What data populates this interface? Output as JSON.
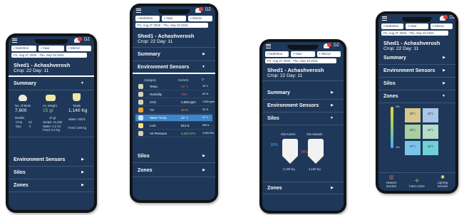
{
  "filters": {
    "chip1": "Nahshon",
    "chip2": "Yaar",
    "chip3": "She12"
  },
  "date_range": "Fri, Aug 27 2020 - Thu, Sep 23 2021",
  "user": "DZ",
  "shed": {
    "title": "Shed1 - Achashverosh",
    "crop_day": "Crop: 22  Day: 11"
  },
  "sections": {
    "summary": "Summary",
    "env": "Environment Sensors",
    "silos": "Silos",
    "zones": "Zones"
  },
  "summary": {
    "birds_label": "No. of Birds",
    "birds_value": "7,600",
    "avg_label": "Av. Weight",
    "avg_value": "15 gr",
    "totals_label": "Totals",
    "totals_value": "1,140 Kg",
    "deaths_label": "Deaths",
    "crop_label": "Crop",
    "crop_value": "24",
    "day_label": "Day",
    "day_value": "2",
    "w1": "10 gr",
    "jumps": "Jumps: 11,332",
    "water1": "Water: 0.2 ml",
    "feed1": "Feed: 0.2 Kg",
    "water2": "Water: 530 lt",
    "feed2": "Feed: 100 Kg"
  },
  "env": {
    "col_category": "Category",
    "col_current": "Current",
    "rows": [
      {
        "name": "Temp.",
        "value": "42 °c",
        "extra": "33 °c"
      },
      {
        "name": "Humidity",
        "value": "78%",
        "extra": "63 %"
      },
      {
        "name": "CO2",
        "value": "2,500 ppm",
        "extra": "1,500 ppm"
      },
      {
        "name": "TH",
        "value": "44 %",
        "extra": "33 %"
      },
      {
        "name": "Water Temp.",
        "value": "22 °c",
        "extra": "22 °c"
      },
      {
        "name": "LUX",
        "value": "812 lx",
        "extra": "600 lx"
      },
      {
        "name": "Air Pressure",
        "value": "3,454 KPA",
        "extra": "3,000 kPa"
      }
    ]
  },
  "silos": {
    "a_name": "Silo Kwesh",
    "b_name": "Silo Nakash",
    "a_pct": "82%",
    "b_pct": "24%",
    "a_kg": "4,150 Kg",
    "b_kg": "4,150 Kg"
  },
  "zones": {
    "cells": [
      "38°c",
      "30°c",
      "28°c",
      "20°c",
      "20°c",
      "25°c"
    ],
    "scale_top": "35c",
    "scale_bot": "19c",
    "btn1": "Heaters Inactive",
    "btn2": "Fans Active",
    "btn3": "Lighting Inactive"
  },
  "colors": {
    "screen_bg": "#1f3859",
    "accent_green": "#8fd06a",
    "alert_red": "#ff5a5a",
    "highlight_blue": "#3f86c9"
  }
}
